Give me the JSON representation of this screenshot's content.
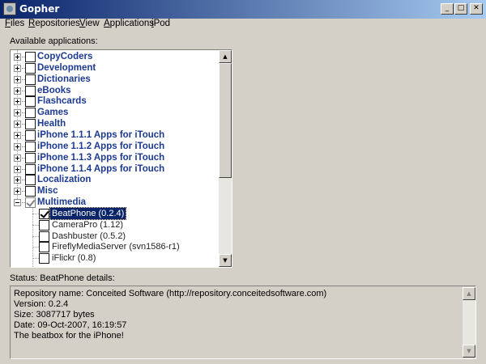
{
  "window": {
    "title": "Gopher",
    "minimize_glyph": "_",
    "maximize_glyph": "□",
    "close_glyph": "✕"
  },
  "menu": [
    {
      "hotkey": "F",
      "rest": "iles"
    },
    {
      "hotkey": "R",
      "rest": "epositories"
    },
    {
      "hotkey": "V",
      "rest": "iew"
    },
    {
      "hotkey": "A",
      "rest": "pplications"
    },
    {
      "hotkey": "i",
      "rest": "Pod"
    }
  ],
  "available_label": "Available applications:",
  "tree": {
    "categories": [
      {
        "label": "CopyCoders",
        "checked": false,
        "expanded": false
      },
      {
        "label": "Development",
        "checked": false,
        "expanded": false
      },
      {
        "label": "Dictionaries",
        "checked": false,
        "expanded": false
      },
      {
        "label": "eBooks",
        "checked": false,
        "expanded": false
      },
      {
        "label": "Flashcards",
        "checked": false,
        "expanded": false
      },
      {
        "label": "Games",
        "checked": false,
        "expanded": false
      },
      {
        "label": "Health",
        "checked": false,
        "expanded": false
      },
      {
        "label": "iPhone 1.1.1 Apps for iTouch",
        "checked": false,
        "expanded": false
      },
      {
        "label": "iPhone 1.1.2 Apps for iTouch",
        "checked": false,
        "expanded": false
      },
      {
        "label": "iPhone 1.1.3 Apps for iTouch",
        "checked": false,
        "expanded": false
      },
      {
        "label": "iPhone 1.1.4 Apps for iTouch",
        "checked": false,
        "expanded": false
      },
      {
        "label": "Localization",
        "checked": false,
        "expanded": false
      },
      {
        "label": "Misc",
        "checked": false,
        "expanded": false
      },
      {
        "label": "Multimedia",
        "checked": true,
        "expanded": true,
        "partial": true
      }
    ],
    "multimedia_apps": [
      {
        "label": "BeatPhone (0.2.4)",
        "checked": true,
        "selected": true
      },
      {
        "label": "CameraPro (1.12)",
        "checked": false,
        "selected": false
      },
      {
        "label": "Dashbuster (0.5.2)",
        "checked": false,
        "selected": false
      },
      {
        "label": "FireflyMediaServer (svn1586-r1)",
        "checked": false,
        "selected": false
      },
      {
        "label": "iFlickr (0.8)",
        "checked": false,
        "selected": false
      }
    ]
  },
  "status_label": "Status:  BeatPhone details:",
  "details": [
    "Repository name: Conceited Software (http://repository.conceitedsoftware.com)",
    "Version: 0.2.4",
    "Size: 3087717 bytes",
    "Date: 09-Oct-2007, 16:19:57",
    "The beatbox for the iPhone!"
  ],
  "colors": {
    "title_gradient_start": "#0a246a",
    "category_text": "#1c3a92",
    "selection": "#0a246a"
  }
}
